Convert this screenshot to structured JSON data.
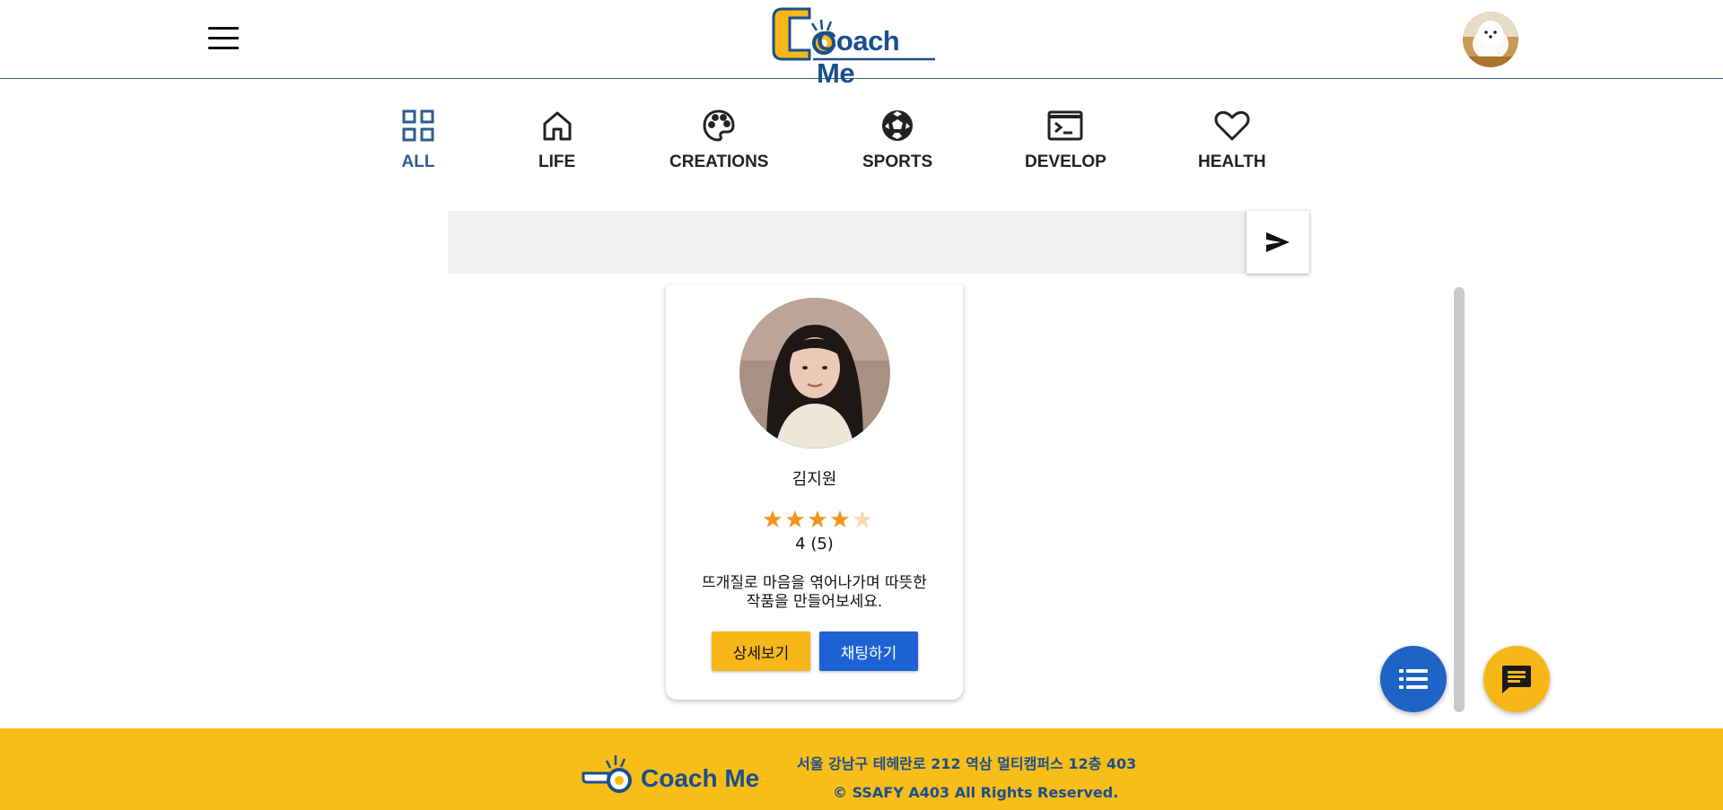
{
  "header": {
    "logo_text": "Coach Me"
  },
  "categories": [
    {
      "label": "ALL",
      "icon": "grid-icon",
      "active": true
    },
    {
      "label": "LIFE",
      "icon": "home-icon",
      "active": false
    },
    {
      "label": "CREATIONS",
      "icon": "palette-icon",
      "active": false
    },
    {
      "label": "SPORTS",
      "icon": "soccer-ball-icon",
      "active": false
    },
    {
      "label": "DEVELOP",
      "icon": "terminal-icon",
      "active": false
    },
    {
      "label": "HEALTH",
      "icon": "heart-icon",
      "active": false
    }
  ],
  "search": {
    "value": "",
    "placeholder": "",
    "button_icon": "send-icon"
  },
  "coach_card": {
    "name": "김지원",
    "stars": 4,
    "max_stars": 5,
    "rating_text": "4 (5)",
    "intro_line1": "뜨개질로 마음을 엮어나가며 따뜻한",
    "intro_line2": "작품을 만들어보세요.",
    "detail_label": "상세보기",
    "chat_label": "채팅하기"
  },
  "fabs": {
    "list_icon": "list-icon",
    "chat_icon": "chat-icon"
  },
  "footer": {
    "logo_text": "Coach Me",
    "address": "서울 강남구 테헤란로 212 역삼 멀티캠퍼스 12층 403",
    "copyright": "© SSAFY A403 All Rights Reserved."
  },
  "colors": {
    "brand_blue": "#1a4f8f",
    "brand_yellow": "#f9bd18",
    "active_category": "#2a5d8f",
    "chat_button": "#1e63d6"
  }
}
